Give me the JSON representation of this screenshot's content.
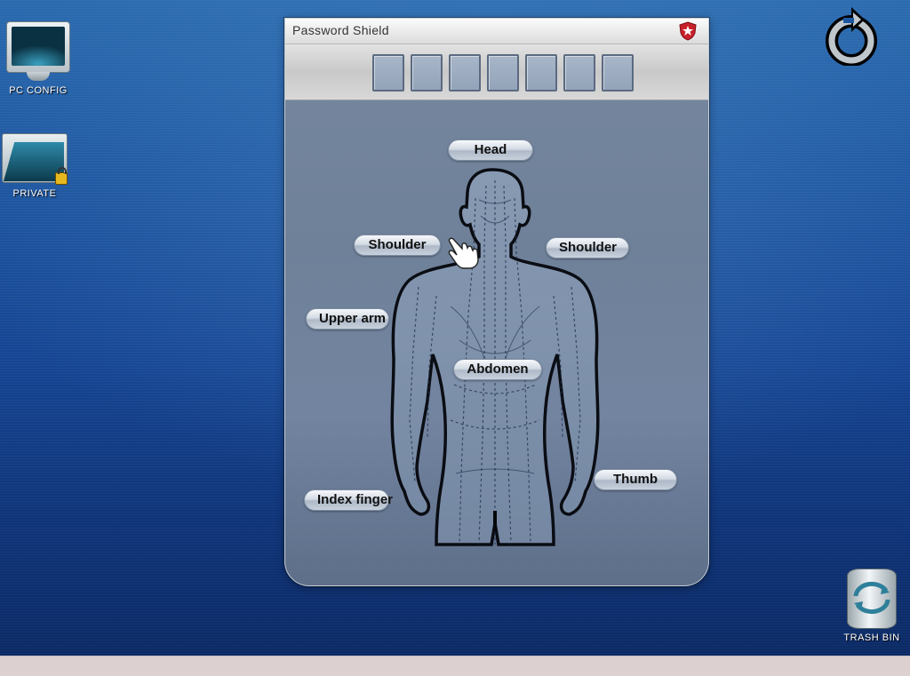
{
  "desktop": {
    "icons": [
      {
        "label": "PC CONFIG",
        "icon": "monitor-icon"
      },
      {
        "label": "PRIVATE",
        "icon": "locked-folder-icon"
      }
    ],
    "refresh_icon": "refresh-icon",
    "trash": {
      "label": "TRASH BIN",
      "icon": "trash-bin-icon"
    }
  },
  "window": {
    "title": "Password Shield",
    "title_icon": "shield-icon",
    "pin_boxes": [
      "",
      "",
      "",
      "",
      "",
      "",
      ""
    ],
    "body_parts": {
      "head": "Head",
      "shoulder_left": "Shoulder",
      "shoulder_right": "Shoulder",
      "upper_arm": "Upper arm",
      "abdomen": "Abdomen",
      "index_finger": "Index finger",
      "thumb": "Thumb"
    }
  },
  "colors": {
    "desktop_top": "#2a6aae",
    "desktop_bottom": "#0b2a66",
    "window_body": "#7384a0",
    "shield_red": "#c8202a"
  }
}
